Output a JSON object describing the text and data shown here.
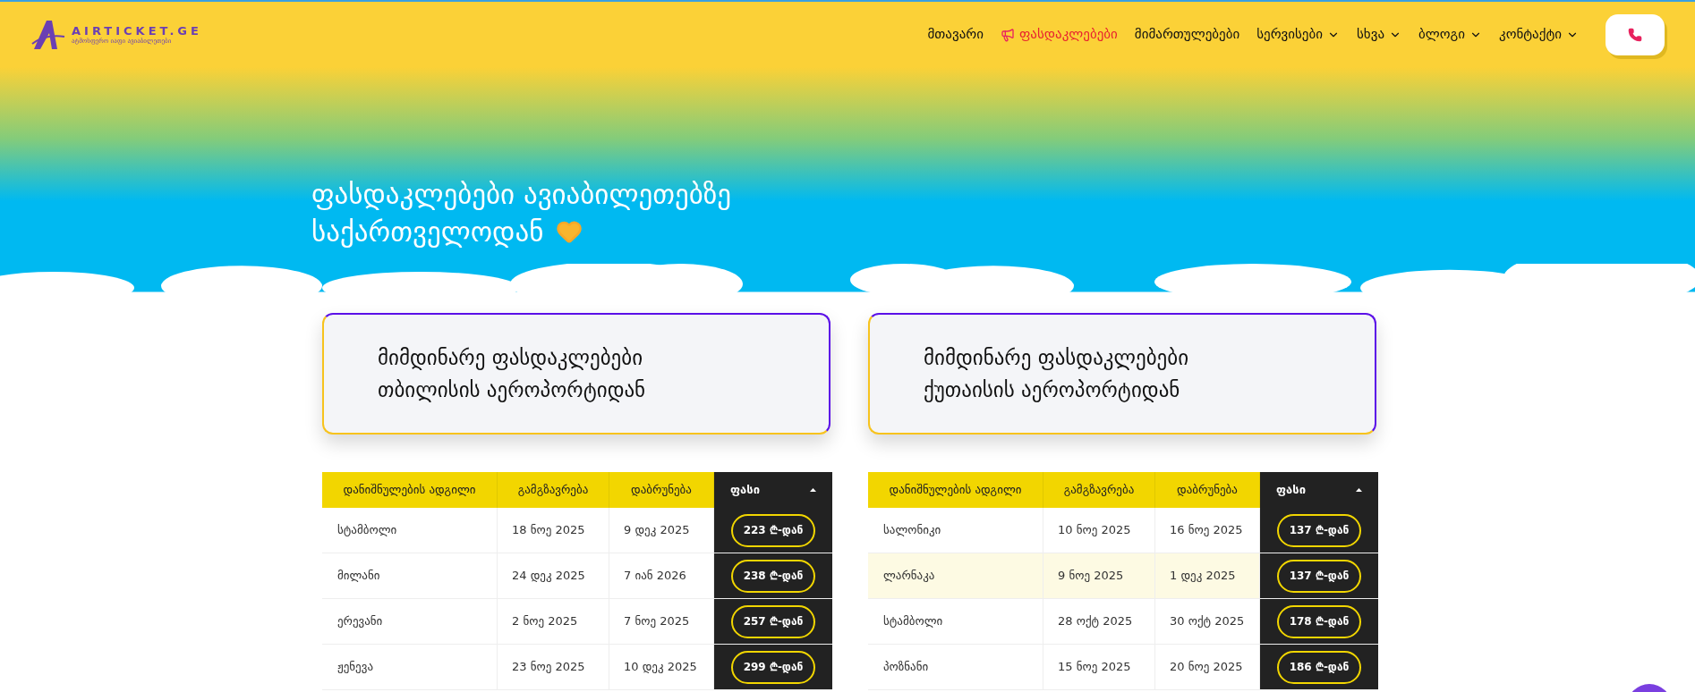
{
  "logo": {
    "name": "AIRTICKET.GE",
    "tagline": "ატმოსფერო იაფი ავიაბილეთები"
  },
  "nav": [
    {
      "label": "მთავარი",
      "selected": false,
      "dropdown": false,
      "promo": false
    },
    {
      "label": "ფასდაკლებები",
      "selected": true,
      "dropdown": false,
      "promo": true
    },
    {
      "label": "მიმართულებები",
      "selected": false,
      "dropdown": false,
      "promo": false
    },
    {
      "label": "სერვისები",
      "selected": false,
      "dropdown": true,
      "promo": false
    },
    {
      "label": "სხვა",
      "selected": false,
      "dropdown": true,
      "promo": false
    },
    {
      "label": "ბლოგი",
      "selected": false,
      "dropdown": true,
      "promo": false
    },
    {
      "label": "კონტაქტი",
      "selected": false,
      "dropdown": true,
      "promo": false
    }
  ],
  "hero": {
    "title_lines": [
      "ფასდაკლებები ავიაბილეთებზე",
      "საქართველოდან"
    ]
  },
  "sections": [
    {
      "title_lines": [
        "მიმდინარე ფასდაკლებები",
        "თბილისის აეროპორტიდან"
      ],
      "table": {
        "columns": [
          "დანიშნულების ადგილი",
          "გამგზავრება",
          "დაბრუნება",
          "ფასი"
        ],
        "rows": [
          {
            "cells": [
              "სტამბოლი",
              "18 ნოე 2025",
              "9 დეკ 2025",
              "223 ₾-დან"
            ],
            "highlighted": false
          },
          {
            "cells": [
              "მილანი",
              "24 დეკ 2025",
              "7 იან 2026",
              "238 ₾-დან"
            ],
            "highlighted": false
          },
          {
            "cells": [
              "ერევანი",
              "2 ნოე 2025",
              "7 ნოე 2025",
              "257 ₾-დან"
            ],
            "highlighted": false
          },
          {
            "cells": [
              "ჟენევა",
              "23 ნოე 2025",
              "10 დეკ 2025",
              "299 ₾-დან"
            ],
            "highlighted": false
          }
        ]
      }
    },
    {
      "title_lines": [
        "მიმდინარე ფასდაკლებები",
        "ქუთაისის აეროპორტიდან"
      ],
      "table": {
        "columns": [
          "დანიშნულების ადგილი",
          "გამგზავრება",
          "დაბრუნება",
          "ფასი"
        ],
        "rows": [
          {
            "cells": [
              "სალონიკი",
              "10 ნოე 2025",
              "16 ნოე 2025",
              "137 ₾-დან"
            ],
            "highlighted": false
          },
          {
            "cells": [
              "ლარნაკა",
              "9 ნოე 2025",
              "1 დეკ 2025",
              "137 ₾-დან"
            ],
            "highlighted": true
          },
          {
            "cells": [
              "სტამბოლი",
              "28 ოქტ 2025",
              "30 ოქტ 2025",
              "178 ₾-დან"
            ],
            "highlighted": false
          },
          {
            "cells": [
              "პოზნანი",
              "15 ნოე 2025",
              "20 ნოე 2025",
              "186 ₾-დან"
            ],
            "highlighted": false
          }
        ]
      }
    }
  ]
}
